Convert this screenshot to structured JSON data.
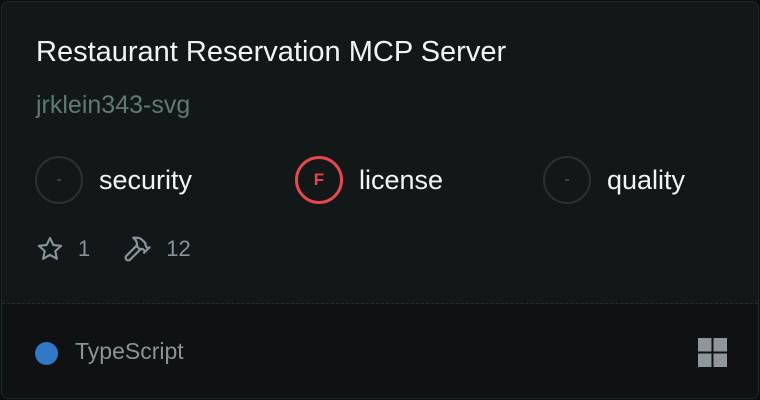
{
  "server": {
    "title": "Restaurant Reservation MCP Server",
    "author": "jrklein343-svg"
  },
  "scores": [
    {
      "grade": "-",
      "label": "security"
    },
    {
      "grade": "F",
      "label": "license"
    },
    {
      "grade": "-",
      "label": "quality"
    }
  ],
  "stats": {
    "stars": "1",
    "tools": "12"
  },
  "language": {
    "name": "TypeScript",
    "color": "#3178c6"
  },
  "colors": {
    "grade_f": "#e5484d",
    "author": "#5e7a72"
  },
  "icons": {
    "stars": "star-icon",
    "tools": "hammer-icon",
    "view": "grid-icon"
  }
}
